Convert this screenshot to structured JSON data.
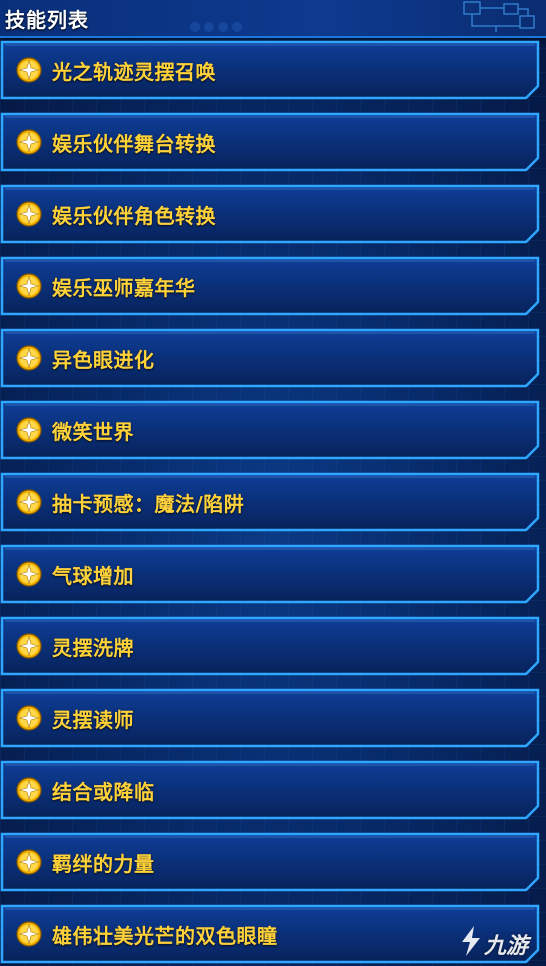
{
  "header": {
    "title": "技能列表"
  },
  "skills": [
    {
      "label": "光之轨迹灵摆召唤",
      "icon": "star-medallion-icon"
    },
    {
      "label": "娱乐伙伴舞台转换",
      "icon": "star-medallion-icon"
    },
    {
      "label": "娱乐伙伴角色转换",
      "icon": "star-medallion-icon"
    },
    {
      "label": "娱乐巫师嘉年华",
      "icon": "star-medallion-icon"
    },
    {
      "label": "异色眼进化",
      "icon": "star-medallion-icon"
    },
    {
      "label": "微笑世界",
      "icon": "star-medallion-icon"
    },
    {
      "label": "抽卡预感：魔法/陷阱",
      "icon": "star-medallion-icon"
    },
    {
      "label": "气球增加",
      "icon": "star-medallion-icon"
    },
    {
      "label": "灵摆洗牌",
      "icon": "star-medallion-icon"
    },
    {
      "label": "灵摆读师",
      "icon": "star-medallion-icon"
    },
    {
      "label": "结合或降临",
      "icon": "star-medallion-icon"
    },
    {
      "label": "羁绊的力量",
      "icon": "star-medallion-icon"
    },
    {
      "label": "雄伟壮美光芒的双色眼瞳",
      "icon": "star-medallion-icon"
    }
  ],
  "watermark": {
    "text": "九游"
  },
  "colors": {
    "label": "#ffd23a",
    "frame_border": "#2fa6ff",
    "item_fill": "#0a2f78",
    "header_fill": "#0d3a8f"
  }
}
